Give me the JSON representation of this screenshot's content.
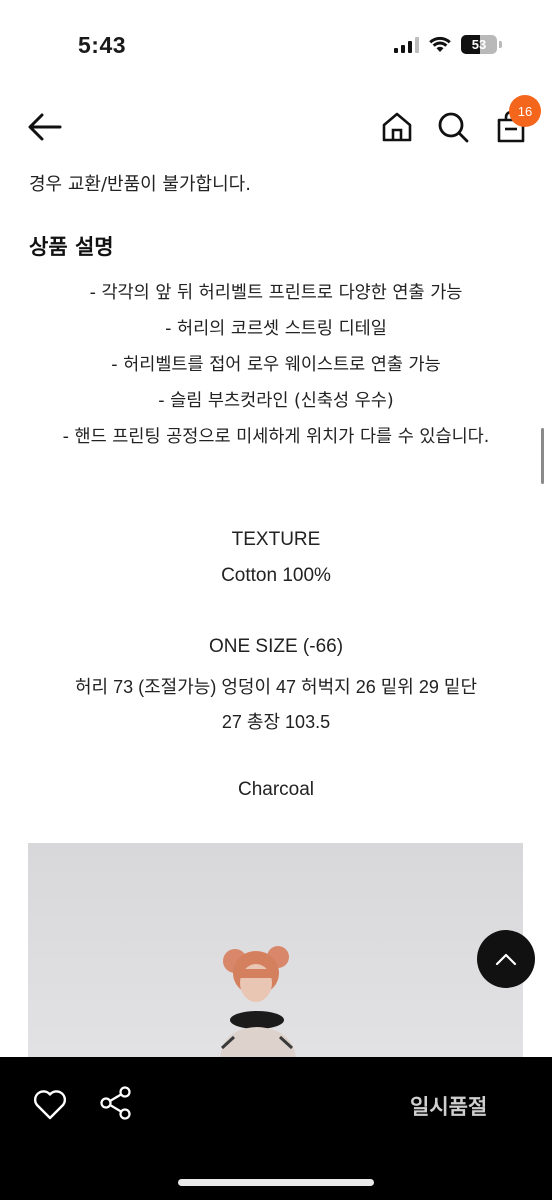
{
  "status_bar": {
    "time": "5:43",
    "battery": "53",
    "battery_level": 0.53,
    "icons": [
      "cellular-signal-icon",
      "wifi-icon",
      "battery-icon"
    ]
  },
  "nav": {
    "icons": [
      "back-arrow-icon",
      "home-icon",
      "search-icon",
      "shopping-bag-icon"
    ],
    "cart_count": "16",
    "accent_color": "#f4661c"
  },
  "content": {
    "notice": "경우 교환/반품이 불가합니다.",
    "section_title": "상품 설명",
    "description_lines": [
      "- 각각의 앞 뒤 허리벨트 프린트로 다양한 연출 가능",
      "- 허리의 코르셋 스트링 디테일",
      "- 허리벨트를 접어 로우 웨이스트로 연출 가능",
      "- 슬림 부츠컷라인 (신축성 우수)",
      "- 핸드 프린팅 공정으로 미세하게 위치가 다를 수 있습니다."
    ],
    "texture_label": "TEXTURE",
    "texture_value": "Cotton 100%",
    "size_label": "ONE SIZE (-66)",
    "size_detail_1": "허리 73 (조절가능) 엉덩이 47 허벅지 26 밑위 29 밑단",
    "size_detail_2": "27 총장 103.5",
    "color": "Charcoal"
  },
  "bottom_bar": {
    "icons": [
      "heart-icon",
      "share-icon"
    ],
    "status_label": "일시품절"
  },
  "fab": {
    "icon": "chevron-up-icon"
  }
}
